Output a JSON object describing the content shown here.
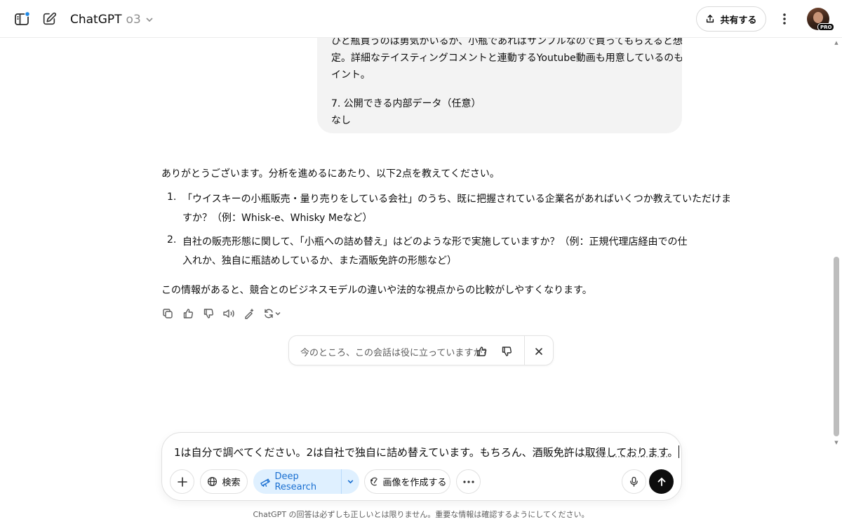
{
  "header": {
    "model_name": "ChatGPT",
    "model_version": "o3",
    "share_label": "共有する",
    "avatar_badge": "PRO"
  },
  "user_message": {
    "lines": [
      "ひと瓶買うのは勇気がいるが、小瓶であればサンプルなので買ってもらえると想",
      "定。詳細なテイスティングコメントと連動するYoutube動画も用意しているのもポ",
      "イント。",
      "7. 公開できる内部データ（任意）",
      "なし"
    ]
  },
  "assistant_message": {
    "intro": "ありがとうございます。分析を進めるにあたり、以下2点を教えてください。",
    "items": [
      {
        "number": "1.",
        "lines": [
          "「ウイスキーの小瓶販売・量り売りをしている会社」のうち、既に把握されている企業名があればいくつか教えていただけま",
          "すか？（例：Whisk-e、Whisky Meなど）"
        ]
      },
      {
        "number": "2.",
        "lines": [
          "自社の販売形態に関して、「小瓶への詰め替え」はどのような形で実施していますか？（例：正規代理店経由での仕",
          "入れか、独自に瓶詰めしているか、また酒販免許の形態など）"
        ]
      }
    ],
    "outro": "この情報があると、競合とのビジネスモデルの違いや法的な視点からの比較がしやすくなります。"
  },
  "feedback": {
    "question": "今のところ、この会話は役に立っていますか？"
  },
  "composer": {
    "text_before": "1は自分で調べてください。2は自社で独自に詰め替えています。もちろん、酒販免許は",
    "text_underlined": "取得しております",
    "text_after": "。",
    "search_label": "検索",
    "deep_research_label": "Deep Research",
    "create_image_label": "画像を作成する"
  },
  "disclaimer": "ChatGPT の回答は必ずしも正しいとは限りません。重要な情報は確認するようにしてください。",
  "colors": {
    "accent_blue": "#1a6fd1",
    "deep_research_bg": "#dff0ff",
    "notification_dot": "#1e88e5",
    "bubble_bg": "#f3f3f3"
  }
}
